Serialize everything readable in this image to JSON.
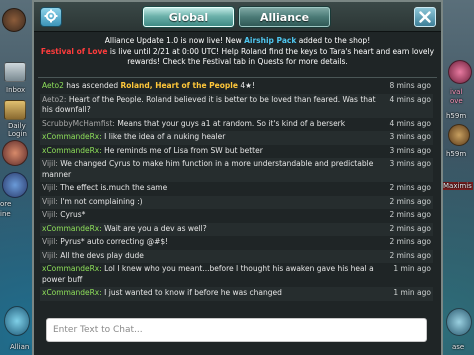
{
  "background": {
    "left_labels": [
      "Inbox",
      "Daily",
      "Login",
      "ore",
      "ine",
      "Allian"
    ],
    "right_labels": [
      "ival",
      "ove",
      "h59m",
      "h59m",
      "Maximis",
      "ase"
    ]
  },
  "header": {
    "settings_icon": "gear-icon",
    "tabs": [
      {
        "label": "Global",
        "active": true
      },
      {
        "label": "Alliance",
        "active": false
      }
    ],
    "close_icon": "close-icon"
  },
  "announcement": {
    "line1_a": "Alliance Update 1.0 is now live! New ",
    "line1_hl": "Airship Pack",
    "line1_b": " added to the shop!",
    "line2_hl": "Festival of Love",
    "line2_b": " is live until 2/21 at 0:00 UTC! Help Roland find the keys to Tara's heart and earn lovely rewards! Check the Festival tab in Quests for more details."
  },
  "messages": [
    {
      "name": "Aeto2",
      "text_a": " has ascended ",
      "highlight": "Roland, Heart of the People",
      "text_b": " 4★!",
      "time": "8 mins ago",
      "name_style": "green",
      "system": true
    },
    {
      "name": "Aeto2:",
      "text": "Heart of the People. Roland believed it is better to be loved than feared. Was that his downfall?",
      "time": "4 mins ago",
      "name_style": "gray"
    },
    {
      "name": "ScrubbyMcHamfist:",
      "text": "Means that your guys a1 at random. So it's kind of a berserk",
      "time": "4 mins ago",
      "name_style": "gray"
    },
    {
      "name": "xCommandeRx:",
      "text": "I like the idea of a nuking healer",
      "time": "3 mins ago",
      "name_style": "green"
    },
    {
      "name": "xCommandeRx:",
      "text": "He reminds me of Lisa from SW but better",
      "time": "3 mins ago",
      "name_style": "green"
    },
    {
      "name": "Vijil:",
      "text": "We changed Cyrus to make him function in a more understandable and predictable manner",
      "time": "3 mins ago",
      "name_style": "gray"
    },
    {
      "name": "Vijil:",
      "text": "The effect is.much the same",
      "time": "2 mins ago",
      "name_style": "gray"
    },
    {
      "name": "Vijil:",
      "text": "I'm not complaining :)",
      "time": "2 mins ago",
      "name_style": "gray"
    },
    {
      "name": "Vijil:",
      "text": "Cyrus*",
      "time": "2 mins ago",
      "name_style": "gray"
    },
    {
      "name": "xCommandeRx:",
      "text": "Wait are you a dev as well?",
      "time": "2 mins ago",
      "name_style": "green"
    },
    {
      "name": "Vijil:",
      "text": "Pyrus* auto correcting @#$!",
      "time": "2 mins ago",
      "name_style": "gray"
    },
    {
      "name": "Vijil:",
      "text": "All the devs play dude",
      "time": "2 mins ago",
      "name_style": "gray"
    },
    {
      "name": "xCommandeRx:",
      "text": "Lol I knew who you meant...before I thought his awaken gave his heal a power buff",
      "time": "1 min ago",
      "name_style": "green"
    },
    {
      "name": "xCommandeRx:",
      "text": "I just wanted to know if before he was changed",
      "time": "1 min ago",
      "name_style": "green"
    }
  ],
  "input": {
    "placeholder": "Enter Text to Chat..."
  },
  "colors": {
    "panel_bg": "#1f2526",
    "name_green": "#8ee05a",
    "highlight_blue": "#4fc7f0",
    "highlight_red": "#ff3c3c",
    "highlight_gold": "#ffc73a"
  }
}
